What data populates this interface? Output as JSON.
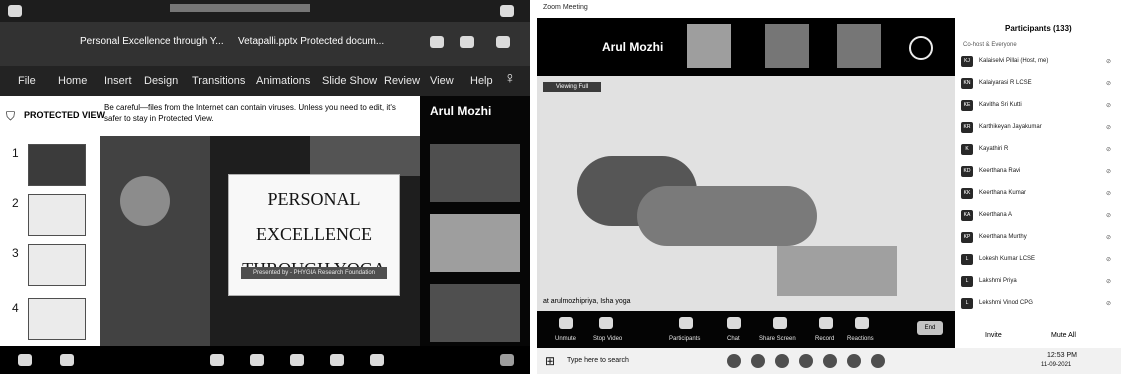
{
  "left": {
    "ppt_title": "Personal Excellence through Y...",
    "ppt_file": "Vetapalli.pptx  Protected  docum...",
    "ribbon": [
      "File",
      "Home",
      "Insert",
      "Design",
      "Transitions",
      "Animations",
      "Slide Show",
      "Review",
      "View",
      "Help"
    ],
    "protected_label": "PROTECTED VIEW",
    "protected_msg": "Be careful—files from the Internet can contain viruses. Unless you need to edit, it's safer to stay in Protected View.",
    "slide_numbers": [
      "1",
      "2",
      "3",
      "4"
    ],
    "slide_title": [
      "PERSONAL",
      "EXCELLENCE",
      "THROUGH YOGA"
    ],
    "slide_sub": "Presented by - PHYGIA Research Foundation",
    "presenter_name": "Arul Mozhi"
  },
  "right": {
    "window_title": "Zoom Meeting",
    "host_name": "Arul Mozhi",
    "speaker_tag": "Viewing Full",
    "video_caption": "at arulmozhipriya, Isha yoga",
    "toolbar_labels": [
      "Unmute",
      "Stop Video",
      "Participants",
      "Chat",
      "Share Screen",
      "Record",
      "Reactions",
      "End"
    ],
    "participants_title": "Participants (133)",
    "participants_subtitle": "Co-host & Everyone",
    "participants": [
      {
        "initials": "KJ",
        "name": "Kalaiselvi Pillai (Host, me)",
        "meta": "⊘"
      },
      {
        "initials": "KN",
        "name": "Kalaiyarasi R LCSE",
        "meta": "⊘"
      },
      {
        "initials": "KE",
        "name": "Kavitha Sri Kutti",
        "meta": "⊘"
      },
      {
        "initials": "KR",
        "name": "Karthikeyan Jayakumar",
        "meta": "⊘"
      },
      {
        "initials": "K",
        "name": "Kayathiri R",
        "meta": "⊘"
      },
      {
        "initials": "KD",
        "name": "Keerthana Ravi",
        "meta": "⊘"
      },
      {
        "initials": "KK",
        "name": "Keerthana Kumar",
        "meta": "⊘"
      },
      {
        "initials": "KA",
        "name": "Keerthana A",
        "meta": "⊘"
      },
      {
        "initials": "KP",
        "name": "Keerthana Murthy",
        "meta": "⊘"
      },
      {
        "initials": "L",
        "name": "Lokesh Kumar LCSE",
        "meta": "⊘"
      },
      {
        "initials": "L",
        "name": "Lakshmi Priya",
        "meta": "⊘"
      },
      {
        "initials": "L",
        "name": "Lekshmi Vinod CPG",
        "meta": "⊘"
      }
    ],
    "participants_footer": [
      "Invite",
      "Mute All"
    ],
    "search_placeholder": "Type here to search",
    "clock": "12:53 PM",
    "date": "11-09-2021"
  }
}
